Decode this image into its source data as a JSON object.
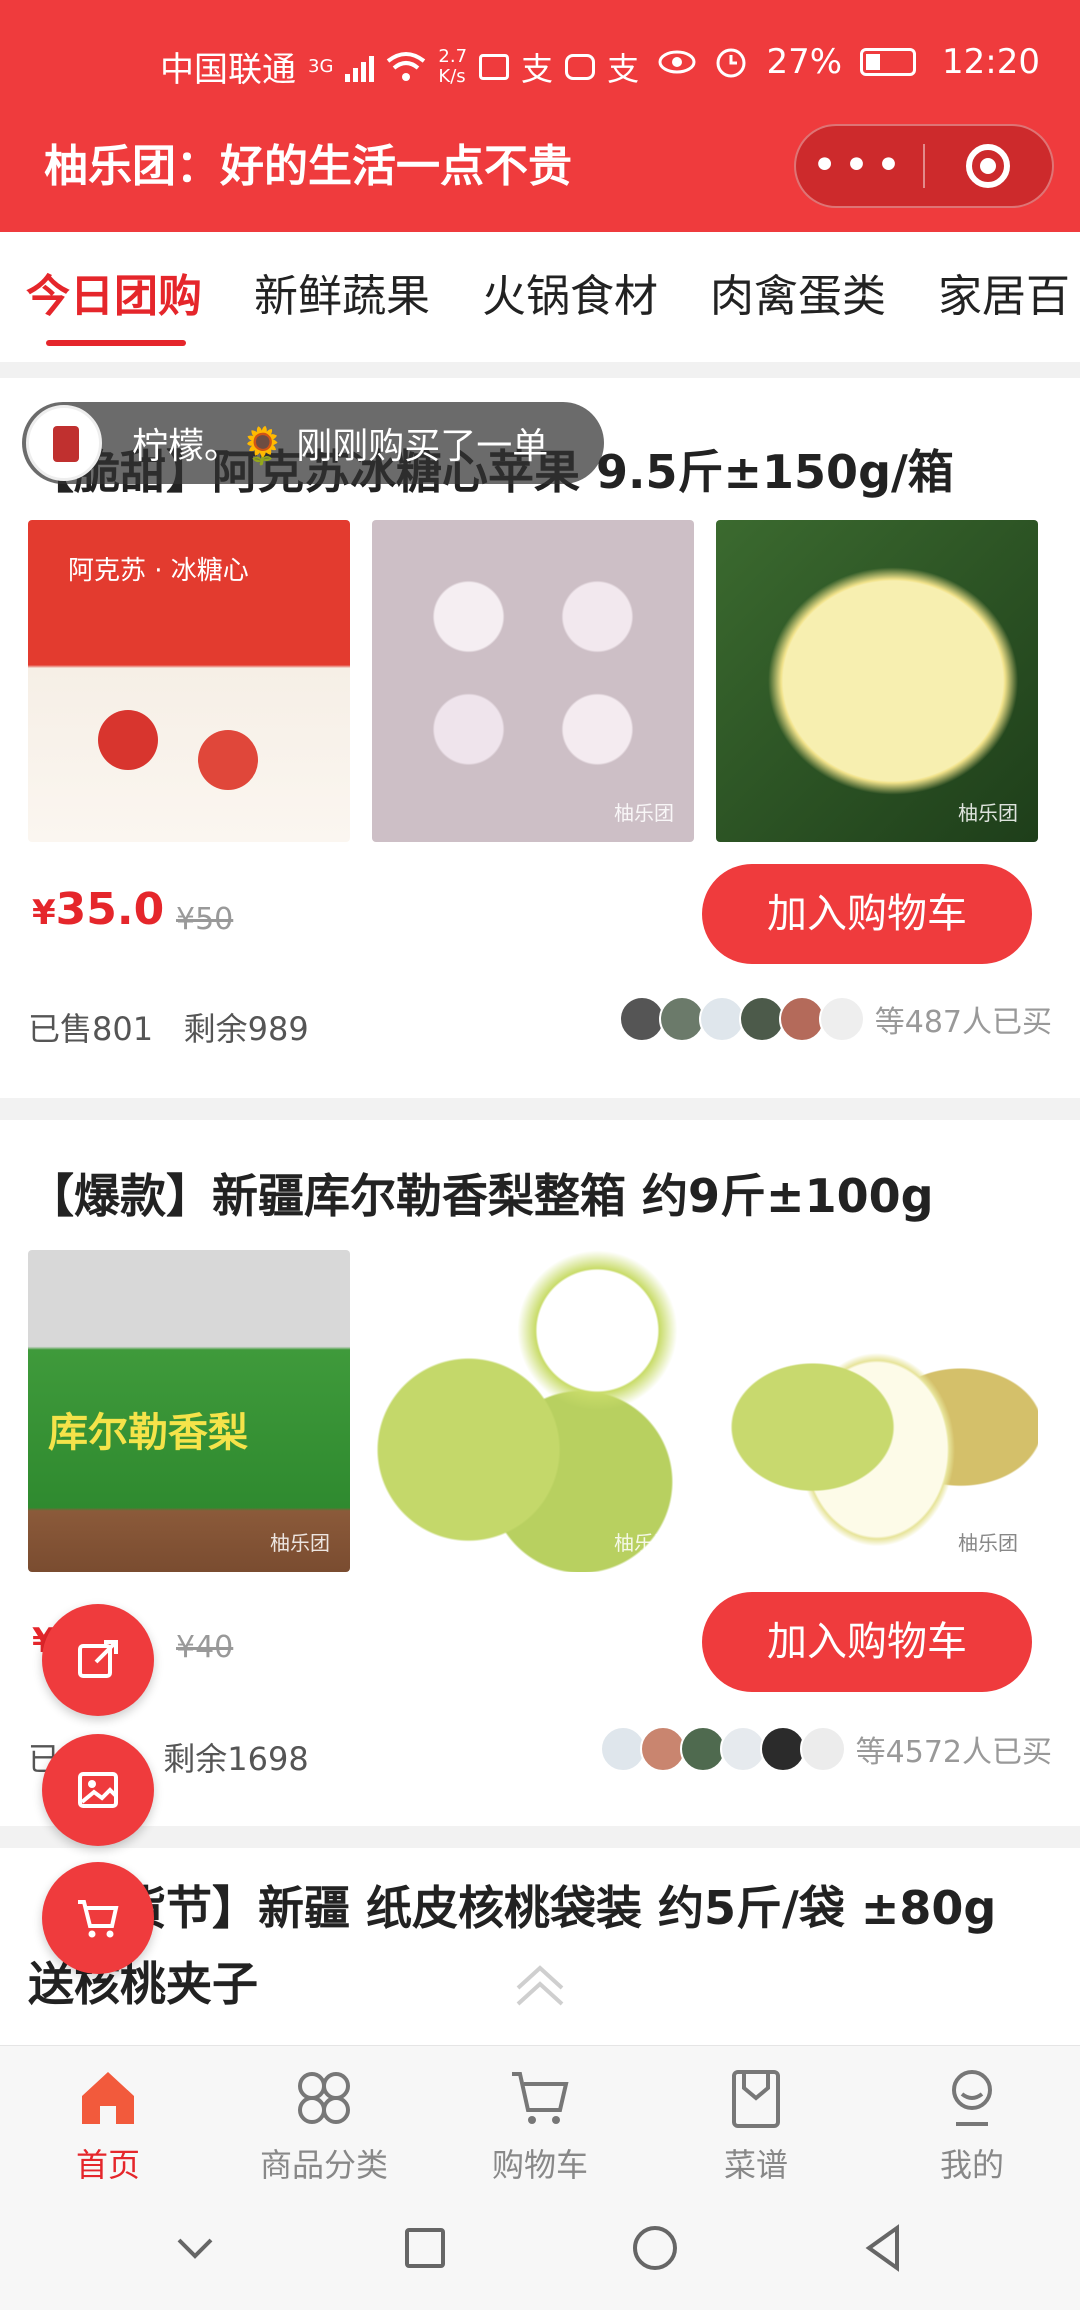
{
  "status_bar": {
    "carrier": "中国联通",
    "network": "3G",
    "speed": "2.7\nK/s",
    "battery": "27%",
    "time": "12:20"
  },
  "header": {
    "title": "柚乐团：好的生活一点不贵",
    "more_label": "•••"
  },
  "tabs": [
    "今日团购",
    "新鲜蔬果",
    "火锅食材",
    "肉禽蛋类",
    "家居百"
  ],
  "toast": {
    "text": "柠檬。🌻 刚刚购买了一单"
  },
  "products": [
    {
      "title": "【脆甜】阿克苏冰糖心苹果 9.5斤±150g/箱",
      "price_symbol": "¥",
      "price": "35.0",
      "original_price": "¥50",
      "cart_label": "加入购物车",
      "sold": "已售801",
      "remaining": "剩余989",
      "buyers": "等487人已买",
      "watermark": "柚乐团"
    },
    {
      "title": "【爆款】新疆库尔勒香梨整箱 约9斤±100g",
      "price_symbol": "¥",
      "price": "",
      "original_price": "¥40",
      "cart_label": "加入购物车",
      "sold": "已售16",
      "remaining": "剩余1698",
      "buyers": "等4572人已买",
      "watermark": "柚乐团"
    },
    {
      "title": "【年货节】新疆 纸皮核桃袋装 约5斤/袋 ±80g 送核桃夹子"
    }
  ],
  "bottom_nav": [
    {
      "label": "首页",
      "icon": "home-icon"
    },
    {
      "label": "商品分类",
      "icon": "category-icon"
    },
    {
      "label": "购物车",
      "icon": "cart-icon"
    },
    {
      "label": "菜谱",
      "icon": "recipe-icon"
    },
    {
      "label": "我的",
      "icon": "profile-icon"
    }
  ],
  "colors": {
    "brand": "#ef3b3d",
    "price": "#e5262b"
  }
}
